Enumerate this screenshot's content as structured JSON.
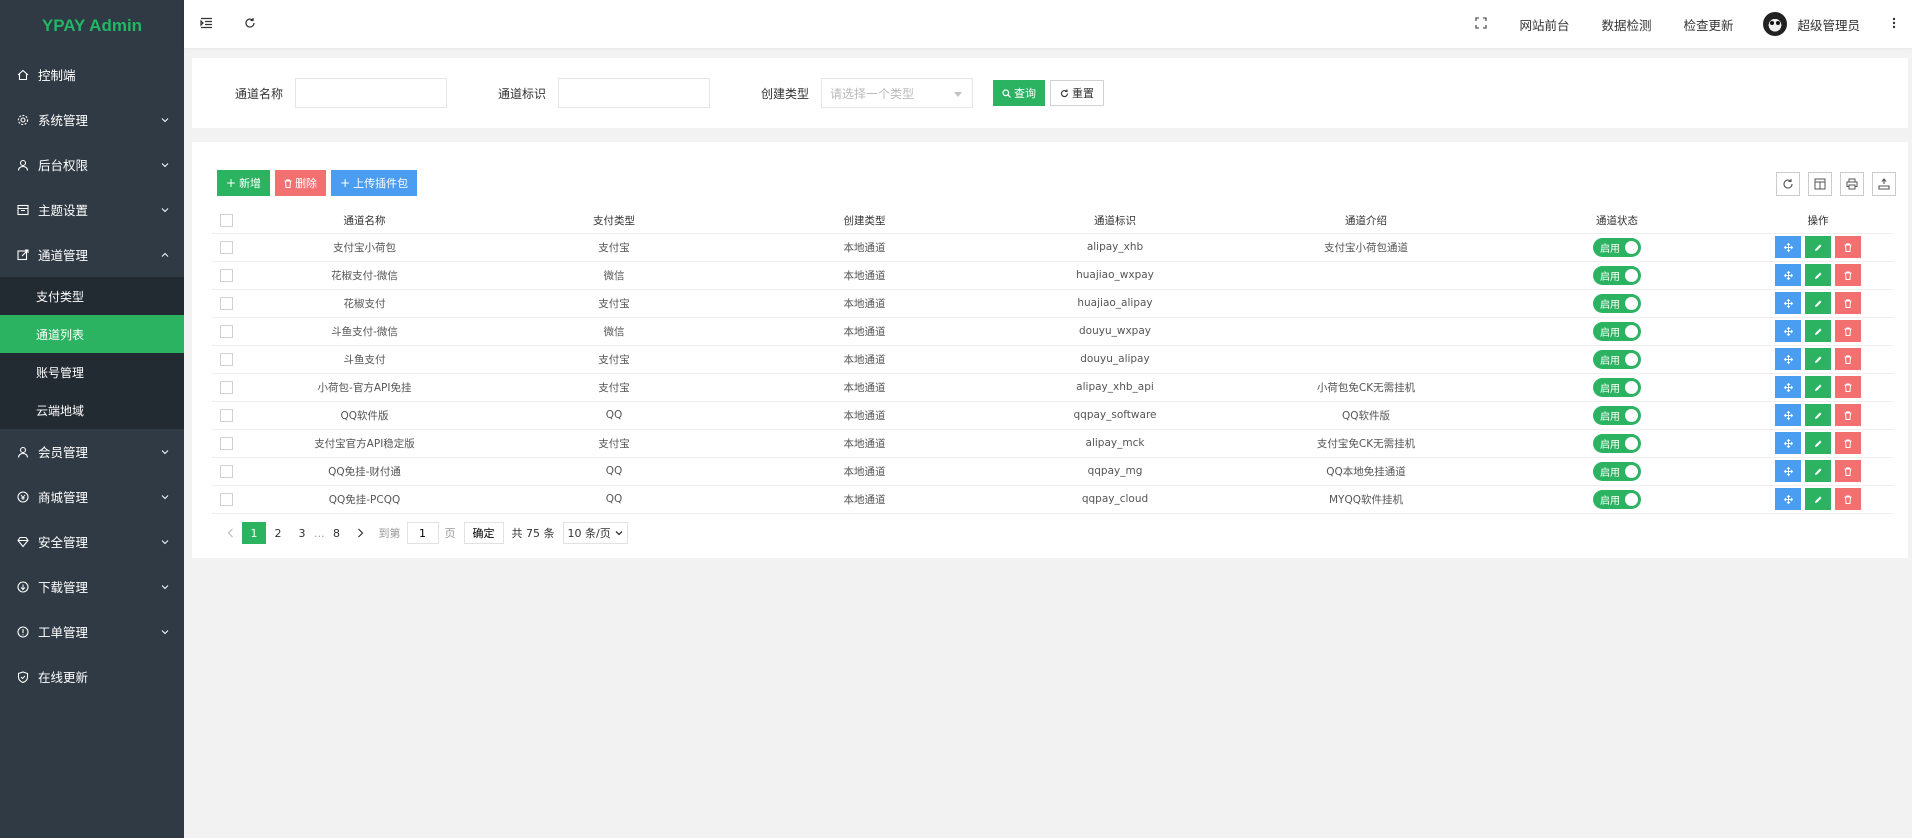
{
  "app": {
    "title": "YPAY Admin"
  },
  "sidebar": {
    "items": [
      {
        "label": "控制端",
        "icon": "home-icon",
        "has_children": false
      },
      {
        "label": "系统管理",
        "icon": "gear-icon",
        "has_children": true
      },
      {
        "label": "后台权限",
        "icon": "user-icon",
        "has_children": true
      },
      {
        "label": "主题设置",
        "icon": "theme-icon",
        "has_children": true
      },
      {
        "label": "通道管理",
        "icon": "channel-icon",
        "has_children": true,
        "expanded": true
      },
      {
        "label": "会员管理",
        "icon": "member-icon",
        "has_children": true
      },
      {
        "label": "商城管理",
        "icon": "shop-icon",
        "has_children": true
      },
      {
        "label": "安全管理",
        "icon": "diamond-icon",
        "has_children": true
      },
      {
        "label": "下载管理",
        "icon": "download-icon",
        "has_children": true
      },
      {
        "label": "工单管理",
        "icon": "ticket-icon",
        "has_children": true
      },
      {
        "label": "在线更新",
        "icon": "shield-check-icon",
        "has_children": false
      }
    ],
    "sub_items": [
      {
        "label": "支付类型",
        "active": false
      },
      {
        "label": "通道列表",
        "active": true
      },
      {
        "label": "账号管理",
        "active": false
      },
      {
        "label": "云端地域",
        "active": false
      }
    ]
  },
  "header": {
    "links": [
      "网站前台",
      "数据检测",
      "检查更新"
    ],
    "user": "超级管理员"
  },
  "search": {
    "name_label": "通道名称",
    "ident_label": "通道标识",
    "type_label": "创建类型",
    "type_placeholder": "请选择一个类型",
    "query_label": "查询",
    "reset_label": "重置"
  },
  "toolbar": {
    "add_label": "新增",
    "delete_label": "删除",
    "upload_label": "上传插件包"
  },
  "table": {
    "columns": [
      "通道名称",
      "支付类型",
      "创建类型",
      "通道标识",
      "通道介绍",
      "通道状态",
      "操作"
    ],
    "rows": [
      {
        "name": "支付宝小荷包",
        "pay_type": "支付宝",
        "create_type": "本地通道",
        "ident": "alipay_xhb",
        "intro": "支付宝小荷包通道",
        "status": "启用"
      },
      {
        "name": "花椒支付-微信",
        "pay_type": "微信",
        "create_type": "本地通道",
        "ident": "huajiao_wxpay",
        "intro": "",
        "status": "启用"
      },
      {
        "name": "花椒支付",
        "pay_type": "支付宝",
        "create_type": "本地通道",
        "ident": "huajiao_alipay",
        "intro": "",
        "status": "启用"
      },
      {
        "name": "斗鱼支付-微信",
        "pay_type": "微信",
        "create_type": "本地通道",
        "ident": "douyu_wxpay",
        "intro": "",
        "status": "启用"
      },
      {
        "name": "斗鱼支付",
        "pay_type": "支付宝",
        "create_type": "本地通道",
        "ident": "douyu_alipay",
        "intro": "",
        "status": "启用"
      },
      {
        "name": "小荷包-官方API免挂",
        "pay_type": "支付宝",
        "create_type": "本地通道",
        "ident": "alipay_xhb_api",
        "intro": "小荷包免CK无需挂机",
        "status": "启用"
      },
      {
        "name": "QQ软件版",
        "pay_type": "QQ",
        "create_type": "本地通道",
        "ident": "qqpay_software",
        "intro": "QQ软件版",
        "status": "启用"
      },
      {
        "name": "支付宝官方API稳定版",
        "pay_type": "支付宝",
        "create_type": "本地通道",
        "ident": "alipay_mck",
        "intro": "支付宝免CK无需挂机",
        "status": "启用"
      },
      {
        "name": "QQ免挂-财付通",
        "pay_type": "QQ",
        "create_type": "本地通道",
        "ident": "qqpay_mg",
        "intro": "QQ本地免挂通道",
        "status": "启用"
      },
      {
        "name": "QQ免挂-PCQQ",
        "pay_type": "QQ",
        "create_type": "本地通道",
        "ident": "qqpay_cloud",
        "intro": "MYQQ软件挂机",
        "status": "启用"
      }
    ]
  },
  "pager": {
    "pages": [
      "1",
      "2",
      "3",
      "...",
      "8"
    ],
    "goto_label": "到第",
    "goto_value": "1",
    "page_unit": "页",
    "confirm_label": "确定",
    "total_label": "共 75 条",
    "page_size_label": "10 条/页"
  },
  "colors": {
    "accent": "#2cb362",
    "danger": "#f27070",
    "info": "#4a9df0",
    "sidebar": "#2f3a44"
  }
}
